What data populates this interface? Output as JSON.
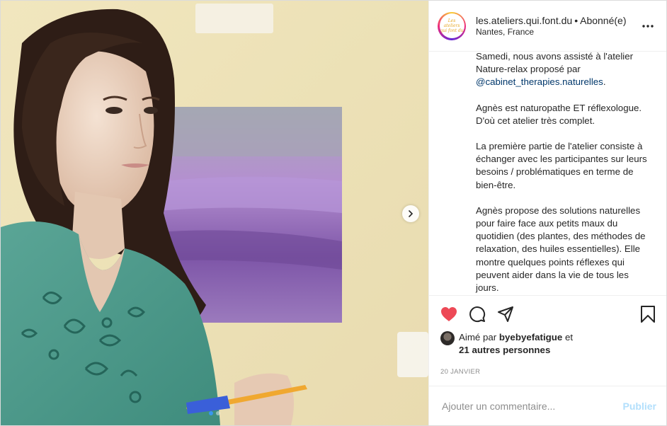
{
  "header": {
    "username": "les.ateliers.qui.font.du",
    "separator": "•",
    "follow_state": "Abonné(e)",
    "location": "Nantes, France",
    "more_icon": "more-horizontal-icon"
  },
  "caption": {
    "p1_before": "Samedi, nous avons assisté à l'atelier Nature-relax proposé par ",
    "p1_mention": "@cabinet_therapies.naturelles",
    "p1_after": ".",
    "p2": "Agnès est naturopathe ET réflexologue. D'où cet atelier très complet.",
    "p3": "La première partie de l'atelier consiste à échanger avec les participantes sur leurs besoins / problématiques en terme de bien-être.",
    "p4": "Agnès propose des solutions naturelles pour faire face aux petits maux du quotidien (des plantes, des méthodes de relaxation, des huiles essentielles). Elle montre quelques points réflexes qui peuvent aider dans la vie de tous les jours."
  },
  "actions": {
    "like_icon": "heart-filled-icon",
    "comment_icon": "comment-icon",
    "share_icon": "paper-plane-icon",
    "save_icon": "bookmark-icon",
    "like_color": "#ed4956"
  },
  "likes": {
    "prefix": "Aimé par ",
    "user": "byebyefatigue",
    "middle": " et",
    "others": "21 autres personnes"
  },
  "date": "20 JANVIER",
  "comment": {
    "placeholder": "Ajouter un commentaire...",
    "publish_label": "Publier",
    "publish_color": "#b2dffc"
  },
  "carousel": {
    "slide_count": 2,
    "active_slide": 1,
    "next_icon": "chevron-right-icon"
  }
}
